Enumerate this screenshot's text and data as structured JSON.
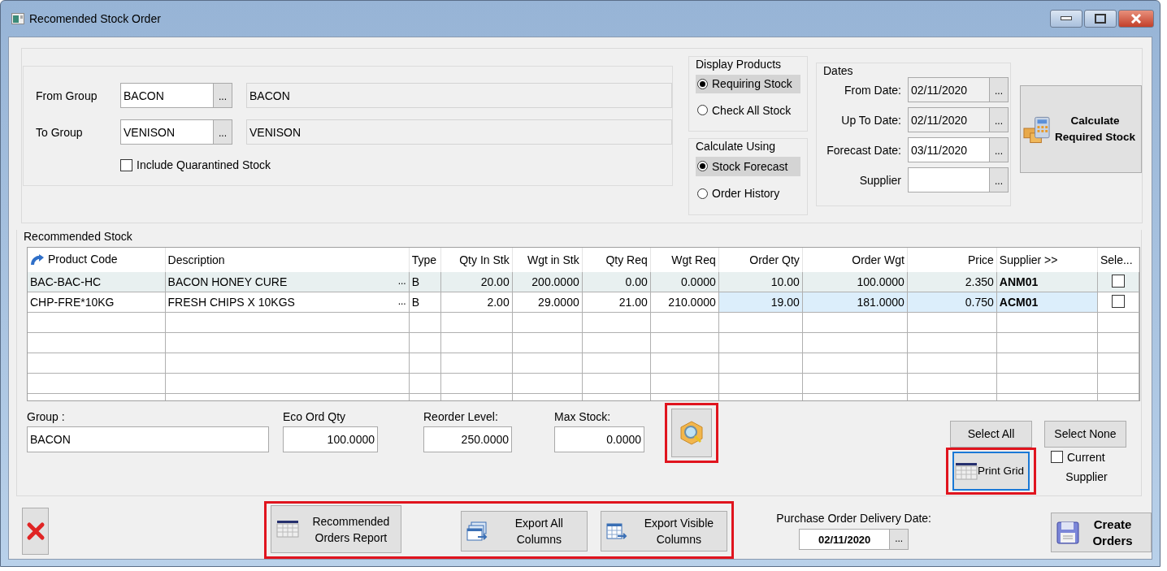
{
  "window": {
    "title": "Recomended Stock Order"
  },
  "group_range": {
    "fields": [
      {
        "label": "From Group",
        "value": "BACON",
        "button": "...",
        "description": "BACON"
      },
      {
        "label": "To Group",
        "value": "VENISON",
        "button": "...",
        "description": "VENISON"
      }
    ],
    "include_quarantined": {
      "label": "Include Quarantined Stock",
      "checked": false
    }
  },
  "display_products": {
    "title": "Display Products",
    "options": [
      {
        "label": "Requiring Stock",
        "selected": true
      },
      {
        "label": "Check All Stock",
        "selected": false
      }
    ]
  },
  "calculate_using": {
    "title": "Calculate Using",
    "options": [
      {
        "label": "Stock Forecast",
        "selected": true
      },
      {
        "label": "Order History",
        "selected": false
      }
    ]
  },
  "dates": {
    "title": "Dates",
    "fields": [
      {
        "label": "From Date:",
        "value": "02/11/2020",
        "button": "...",
        "disabled": true
      },
      {
        "label": "Up To Date:",
        "value": "02/11/2020",
        "button": "...",
        "disabled": true
      },
      {
        "label": "Forecast Date:",
        "value": "03/11/2020",
        "button": "...",
        "disabled": false
      },
      {
        "label": "Supplier",
        "button": "...",
        "disabled": false
      }
    ]
  },
  "calculate_button": {
    "label": "Calculate Required Stock"
  },
  "recommended_stock": {
    "title": "Recommended Stock",
    "columns": [
      {
        "label": "Product Code",
        "kind": "code"
      },
      {
        "label": "Description",
        "kind": "lookup"
      },
      {
        "label": "Type",
        "kind": "text"
      },
      {
        "label": "Qty In Stk",
        "kind": "number"
      },
      {
        "label": "Wgt in Stk",
        "kind": "number"
      },
      {
        "label": "Qty Req",
        "kind": "number"
      },
      {
        "label": "Wgt Req",
        "kind": "number"
      },
      {
        "label": "Order Qty",
        "kind": "order"
      },
      {
        "label": "Order Wgt",
        "kind": "order"
      },
      {
        "label": "Price",
        "kind": "order"
      },
      {
        "label": "Supplier >>",
        "kind": "supplier"
      },
      {
        "label": "Sele...",
        "kind": "checkbox"
      }
    ],
    "rows": [
      {
        "cells": [
          "BAC-BAC-HC",
          "BACON HONEY CURE",
          "B",
          "20.00",
          "200.0000",
          "0.00",
          "0.0000",
          "10.00",
          "100.0000",
          "2.350",
          "ANM01"
        ],
        "lookup_button": "...",
        "checked": false,
        "selected": true,
        "modified": false
      },
      {
        "cells": [
          "CHP-FRE*10KG",
          "FRESH CHIPS X  10KGS",
          "B",
          "2.00",
          "29.0000",
          "21.00",
          "210.0000",
          "19.00",
          "181.0000",
          "0.750",
          "ACM01"
        ],
        "lookup_button": "...",
        "checked": false,
        "selected": false,
        "modified": true
      }
    ]
  },
  "details": [
    {
      "label": "Group :",
      "value": "BACON"
    },
    {
      "label": "Eco Ord Qty",
      "value": "100.0000"
    },
    {
      "label": "Reorder Level:",
      "value": "250.0000"
    },
    {
      "label": "Max Stock:",
      "value": "0.0000"
    }
  ],
  "find_button": {
    "highlighted": true
  },
  "select_all": {
    "label": "Select All"
  },
  "select_none": {
    "label": "Select None"
  },
  "print_grid": {
    "label": "Print Grid",
    "focused": true,
    "highlighted": true
  },
  "current_supplier": {
    "label": "Current",
    "label_2": "Supplier",
    "checked": false
  },
  "report_buttons": {
    "highlighted": true,
    "buttons": [
      {
        "label": "Recommended Orders Report",
        "kind": "report"
      },
      {
        "label": "Export All Columns",
        "kind": "export_all"
      },
      {
        "label": "Export Visible Columns",
        "kind": "export_visible"
      }
    ]
  },
  "delivery_date": {
    "label": "Purchase Order Delivery Date:",
    "value": "02/11/2020",
    "button": "..."
  },
  "create_orders": {
    "label": "Create Orders"
  }
}
